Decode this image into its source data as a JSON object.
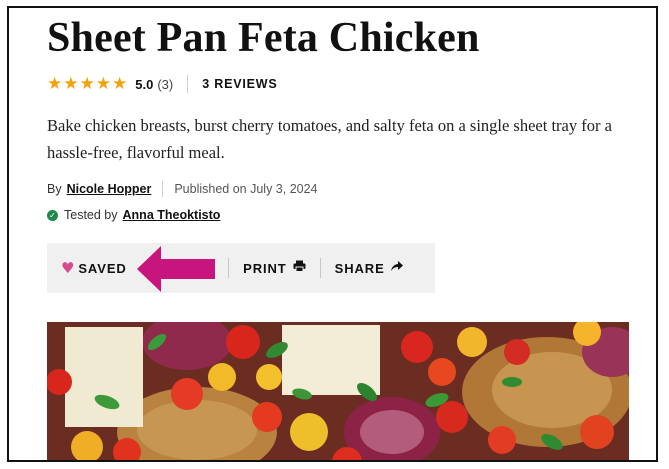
{
  "recipe": {
    "title": "Sheet Pan Feta Chicken",
    "rating": {
      "stars_filled": 5,
      "value": "5.0",
      "count": "(3)",
      "reviews_label": "3 REVIEWS"
    },
    "summary": "Bake chicken breasts, burst cherry tomatoes, and salty feta on a single sheet tray for a hassle-free, flavorful meal.",
    "byline": {
      "by_label": "By",
      "author": "Nicole Hopper",
      "published": "Published on July 3, 2024"
    },
    "tested": {
      "label": "Tested by",
      "tester": "Anna Theoktisto"
    }
  },
  "action_bar": {
    "saved_label": "SAVED",
    "print_label": "PRINT",
    "share_label": "SHARE"
  },
  "icons": {
    "heart": "heart-icon",
    "rate": "star-outline-icon",
    "print": "printer-icon",
    "share": "share-arrow-icon",
    "annotation": "arrow-pointer-icon"
  },
  "colors": {
    "star": "#f0a30a",
    "heart": "#d64b8b",
    "arrow": "#c8157e",
    "check": "#1e8a4c",
    "action_bar_bg": "#f0f0f0"
  }
}
